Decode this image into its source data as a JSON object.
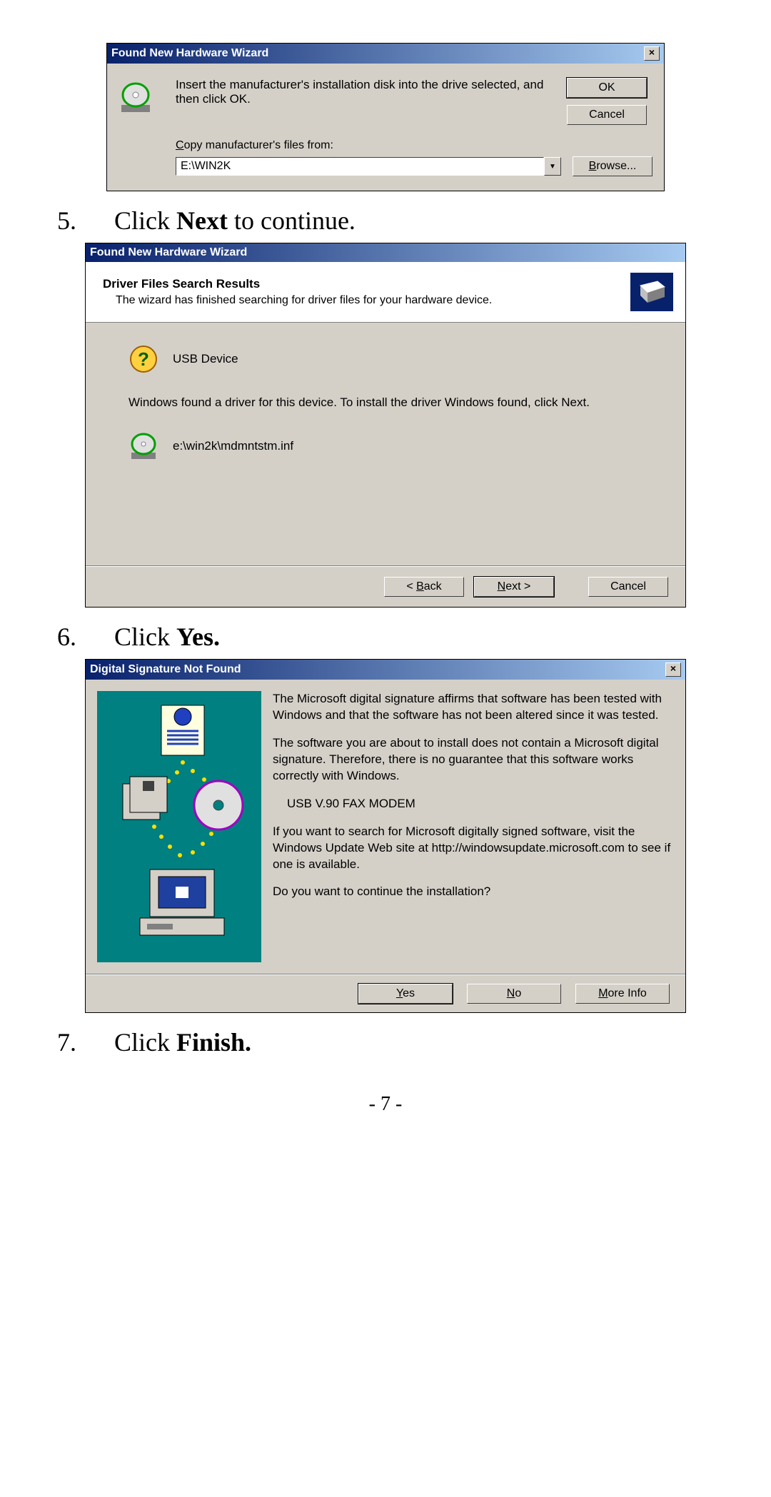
{
  "steps": {
    "s5_num": "5.",
    "s5_txt_pre": "Click ",
    "s5_txt_bold": "Next",
    "s5_txt_post": " to continue.",
    "s6_num": "6.",
    "s6_txt_pre": "Click ",
    "s6_txt_bold": "Yes.",
    "s7_num": "7.",
    "s7_txt_pre": "Click ",
    "s7_txt_bold": "Finish."
  },
  "page_number": "- 7 -",
  "d1": {
    "title": "Found New Hardware Wizard",
    "close": "×",
    "instruction": "Insert the manufacturer's installation disk into the drive selected, and then click OK.",
    "ok": "OK",
    "cancel": "Cancel",
    "copy_label_pre": "C",
    "copy_label_rest": "opy manufacturer's files from:",
    "path_value": "E:\\WIN2K",
    "browse_pre": "B",
    "browse_rest": "rowse..."
  },
  "d2": {
    "title": "Found New Hardware Wizard",
    "header_title": "Driver Files Search Results",
    "header_sub": "The wizard has finished searching for driver files for your hardware device.",
    "usb_device": "USB Device",
    "found_text": "Windows found a driver for this device. To install the driver Windows found, click Next.",
    "inf_path": "e:\\win2k\\mdmntstm.inf",
    "back_pre": "< ",
    "back_u": "B",
    "back_rest": "ack",
    "next_u": "N",
    "next_rest": "ext >",
    "cancel": "Cancel"
  },
  "d3": {
    "title": "Digital Signature Not Found",
    "close": "×",
    "p1": "The Microsoft digital signature affirms that software has been tested with Windows and that the software has not been altered since it was tested.",
    "p2": "The software you are about to install does not contain a Microsoft digital signature. Therefore, there is no guarantee that this software works correctly with Windows.",
    "device": "USB V.90 FAX MODEM",
    "p3": "If you want to search for Microsoft digitally signed software, visit the Windows Update Web site at http://windowsupdate.microsoft.com to see if one is available.",
    "p4": "Do you want to continue the installation?",
    "yes_u": "Y",
    "yes_rest": "es",
    "no_u": "N",
    "no_rest": "o",
    "more_u": "M",
    "more_rest": "ore Info"
  }
}
